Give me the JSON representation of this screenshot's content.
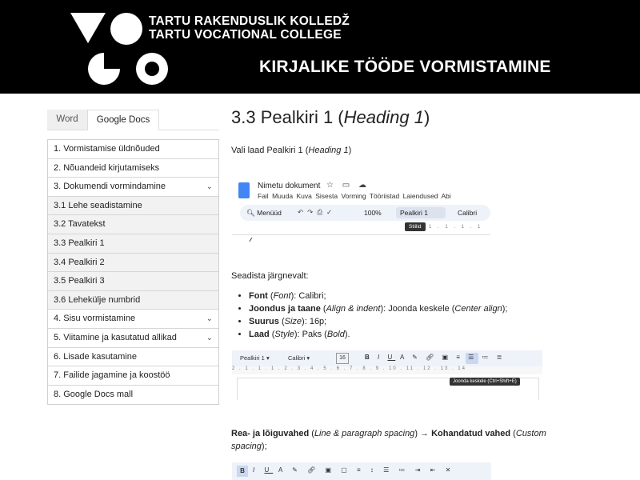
{
  "header": {
    "college_line1": "TARTU RAKENDUSLIK KOLLEDŽ",
    "college_line2": "TARTU VOCATIONAL COLLEGE",
    "title": "KIRJALIKE TÖÖDE VORMISTAMINE"
  },
  "sidebar": {
    "tabs": [
      "Word",
      "Google Docs"
    ],
    "active_tab": "Google Docs",
    "items": [
      {
        "label": "1. Vormistamise üldnõuded",
        "sub": false,
        "expandable": false
      },
      {
        "label": "2. Nõuandeid kirjutamiseks",
        "sub": false,
        "expandable": false
      },
      {
        "label": "3. Dokumendi vormindamine",
        "sub": false,
        "expandable": true
      },
      {
        "label": "3.1 Lehe seadistamine",
        "sub": true,
        "expandable": false
      },
      {
        "label": "3.2 Tavatekst",
        "sub": true,
        "expandable": false
      },
      {
        "label": "3.3 Pealkiri 1",
        "sub": true,
        "expandable": false
      },
      {
        "label": "3.4 Pealkiri 2",
        "sub": true,
        "expandable": false
      },
      {
        "label": "3.5 Pealkiri 3",
        "sub": true,
        "expandable": false
      },
      {
        "label": "3.6 Lehekülje numbrid",
        "sub": true,
        "expandable": false
      },
      {
        "label": "4. Sisu vormistamine",
        "sub": false,
        "expandable": true
      },
      {
        "label": "5. Viitamine ja kasutatud allikad",
        "sub": false,
        "expandable": true
      },
      {
        "label": "6. Lisade kasutamine",
        "sub": false,
        "expandable": false
      },
      {
        "label": "7. Failide jagamine ja koostöö",
        "sub": false,
        "expandable": false
      },
      {
        "label": "8. Google Docs mall",
        "sub": false,
        "expandable": false
      }
    ]
  },
  "main": {
    "heading_prefix": "3.3 Pealkiri 1 (",
    "heading_em": "Heading 1",
    "heading_suffix": ")",
    "intro_prefix": "Vali laad Pealkiri 1 (",
    "intro_em": "Heading 1",
    "intro_suffix": ")",
    "settings_intro": "Seadista järgnevalt:",
    "bullets": [
      {
        "bold": "Font",
        "open": " (",
        "em": "Font",
        "rest": "): Calibri;"
      },
      {
        "bold": "Joondus ja taane",
        "open": " (",
        "em": "Align & indent",
        "rest": "): Joonda keskele (",
        "em2": "Center align",
        "rest2": ");"
      },
      {
        "bold": "Suurus",
        "open": " (",
        "em": "Size",
        "rest": "): 16p;"
      },
      {
        "bold": "Laad",
        "open": " (",
        "em": "Style",
        "rest": "): Paks (",
        "em2": "Bold",
        "rest2": ")."
      }
    ],
    "spacing": {
      "bold1": "Rea- ja lõiguvahed",
      "em1": "Line & paragraph spacing",
      "arrow": " → ",
      "bold2": "Kohandatud vahed",
      "em2": "Custom spacing",
      "end": ");"
    }
  },
  "screenshot1": {
    "doc_name": "Nimetu dokument",
    "menu": [
      "Fail",
      "Muuda",
      "Kuva",
      "Sisesta",
      "Vorming",
      "Tööriistad",
      "Laiendused",
      "Abi"
    ],
    "menus_button": "Menüüd",
    "zoom": "100%",
    "style_select": "Pealkiri 1",
    "font_select": "Calibri",
    "tooltip": "Stiilid"
  },
  "screenshot2": {
    "style_select": "Pealkiri 1",
    "font_select": "Calibri",
    "font_size": "16",
    "tooltip": "Joonda keskele (Ctrl+Shift+E)"
  },
  "icon_colors": {
    "docs_blue": "#4285f4",
    "active_bg": "#c9d7f2",
    "toolbar_bg": "#eef2f9"
  }
}
